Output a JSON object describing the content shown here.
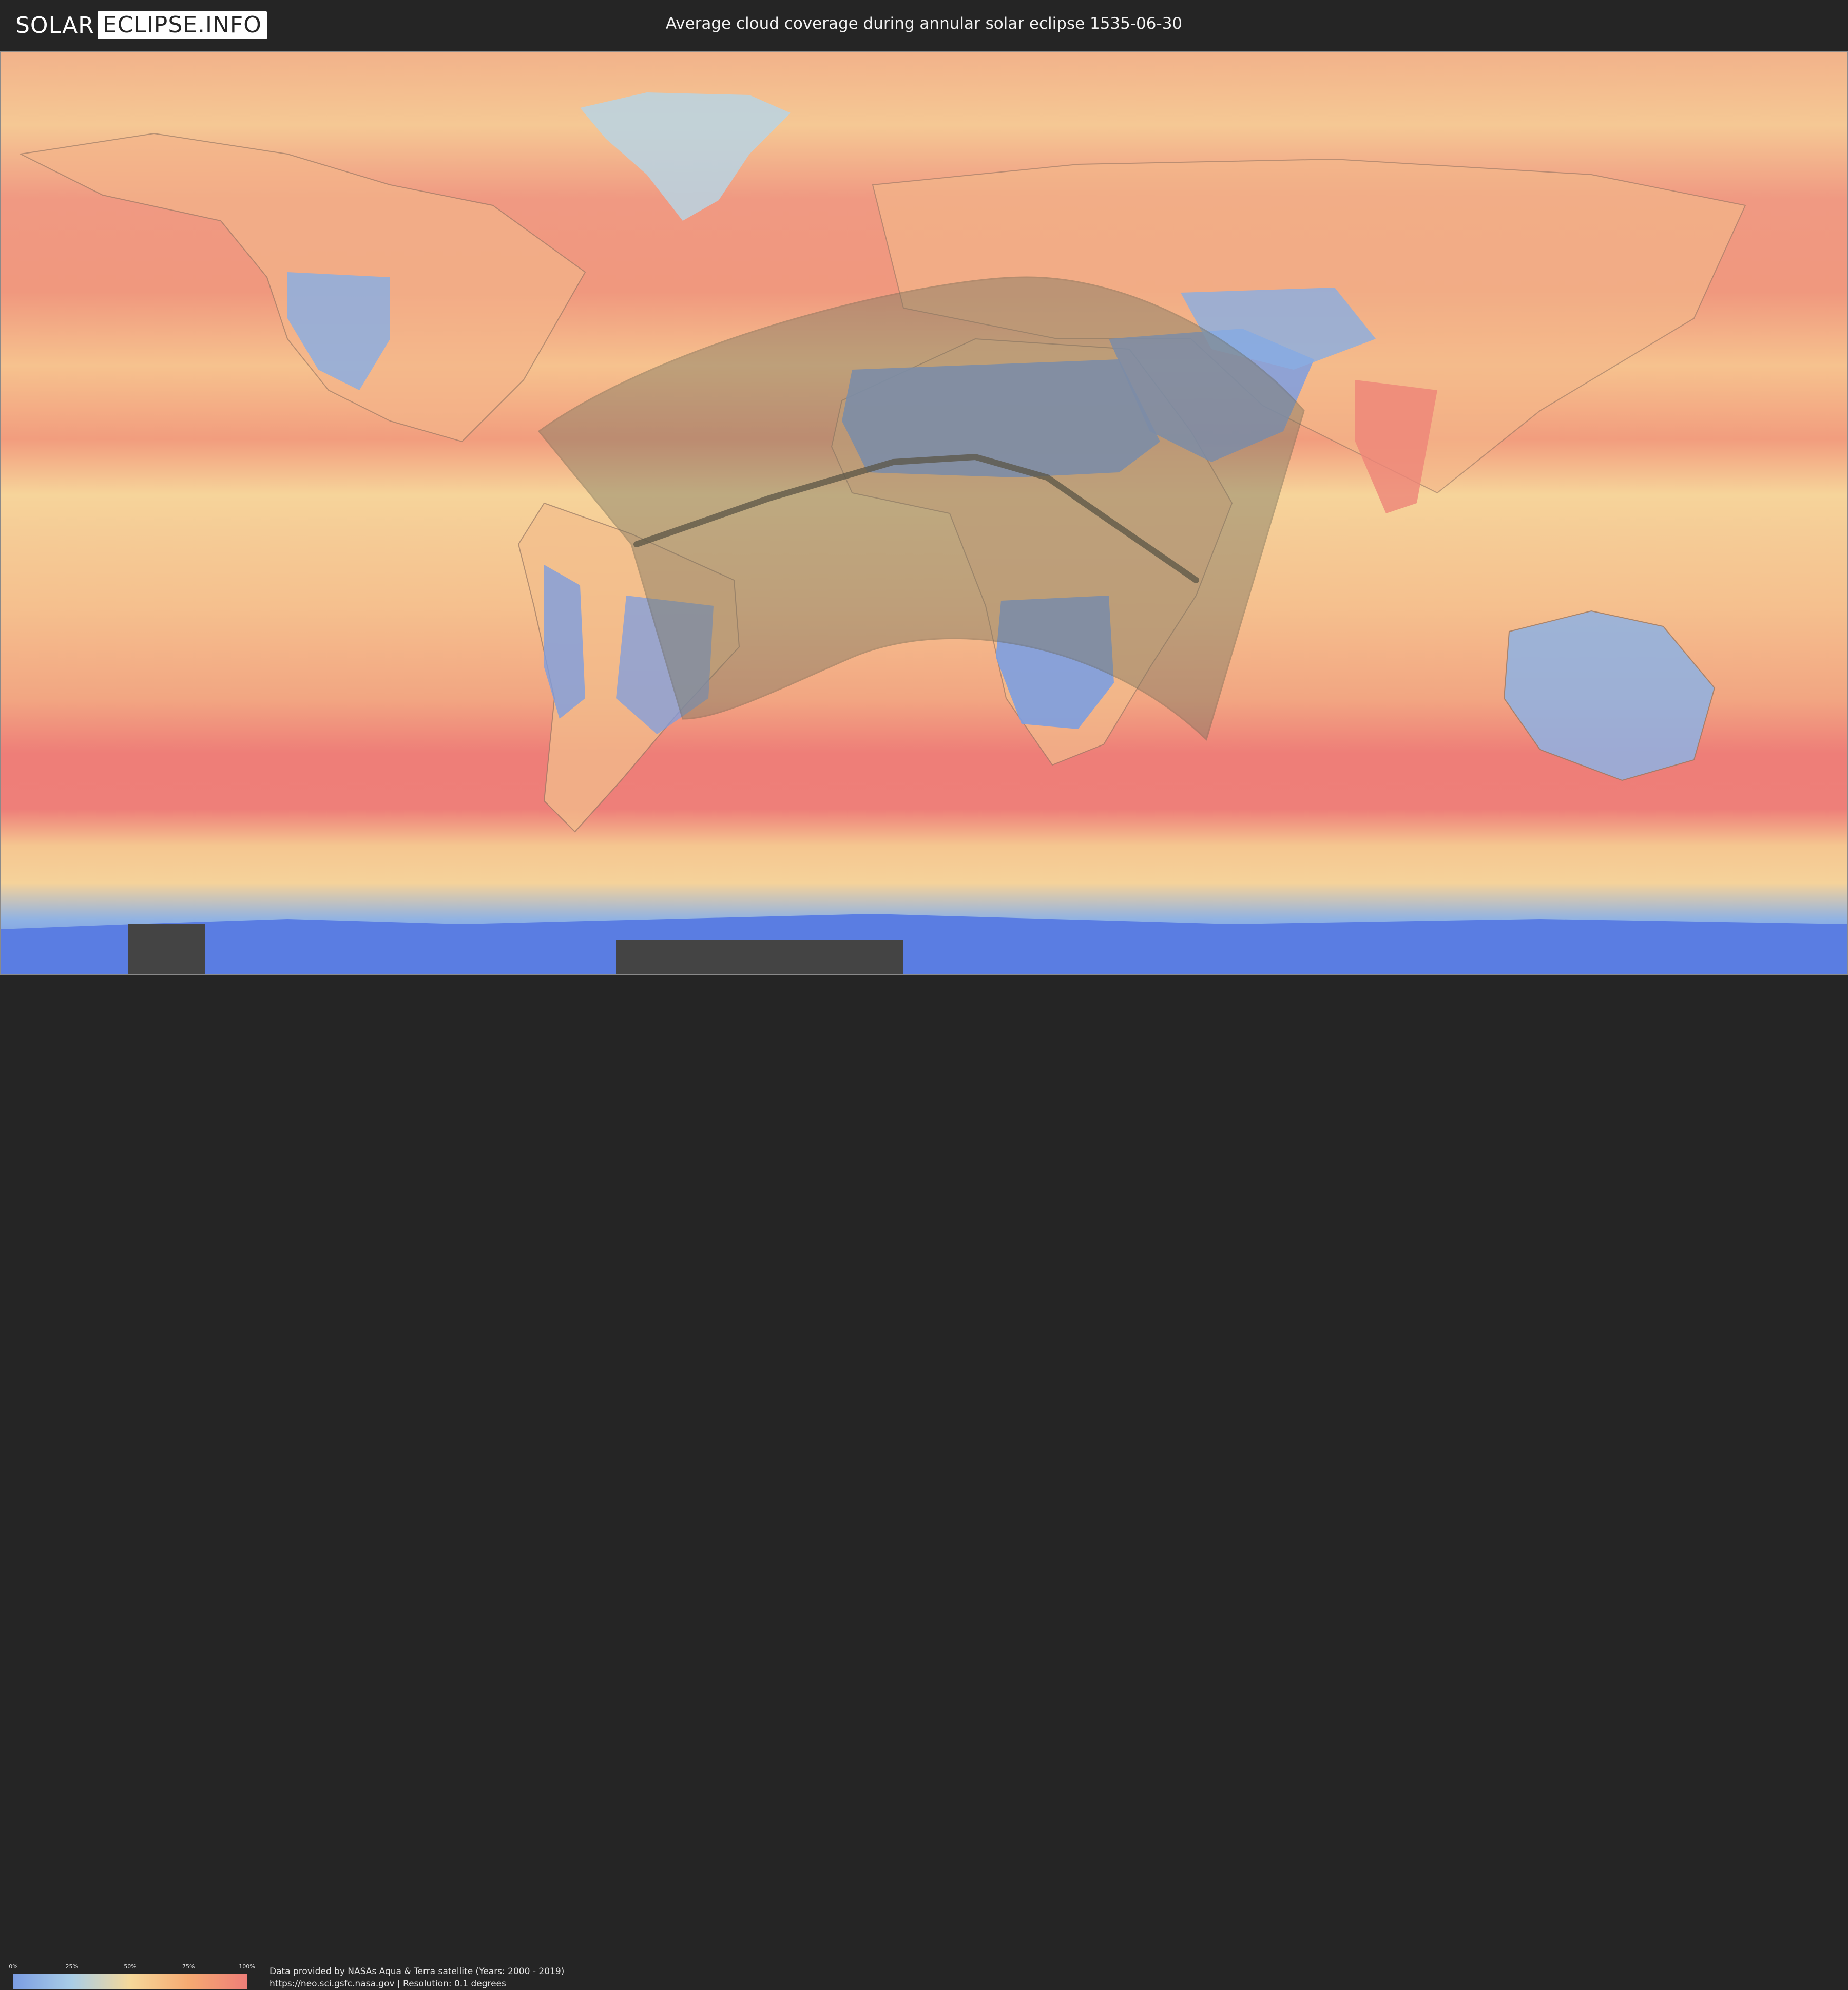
{
  "header": {
    "logo": {
      "part1": "SOLAR",
      "part2": "ECLIPSE.INFO"
    },
    "title": "Average cloud coverage during annular solar eclipse 1535-06-30"
  },
  "legend": {
    "ticks": [
      "0%",
      "25%",
      "50%",
      "75%",
      "100%"
    ],
    "colors": [
      "#7b9de3",
      "#a9cde6",
      "#f5d89a",
      "#f5aa72",
      "#ee7e78"
    ]
  },
  "footer": {
    "credit_line1": "Data provided by NASAs Aqua & Terra satellite (Years: 2000 - 2019)",
    "credit_line2": "https://neo.sci.gsfc.nasa.gov | Resolution: 0.1 degrees"
  },
  "map": {
    "projection": "equirectangular",
    "colors": {
      "ocean_cloudy": "#ef8a7c",
      "ocean_mid": "#f6c08c",
      "clear": "#7d9ee0",
      "polar": "#5b7ee0",
      "eclipse_zone": "#8a8366",
      "central_line": "#5a5446"
    },
    "eclipse_central_line": [
      {
        "lon": -56,
        "lat": -6
      },
      {
        "lon": -30,
        "lat": 3
      },
      {
        "lon": -6,
        "lat": 10
      },
      {
        "lon": 10,
        "lat": 11
      },
      {
        "lon": 24,
        "lat": 7
      },
      {
        "lon": 37,
        "lat": -2
      },
      {
        "lon": 53,
        "lat": -13
      }
    ]
  }
}
